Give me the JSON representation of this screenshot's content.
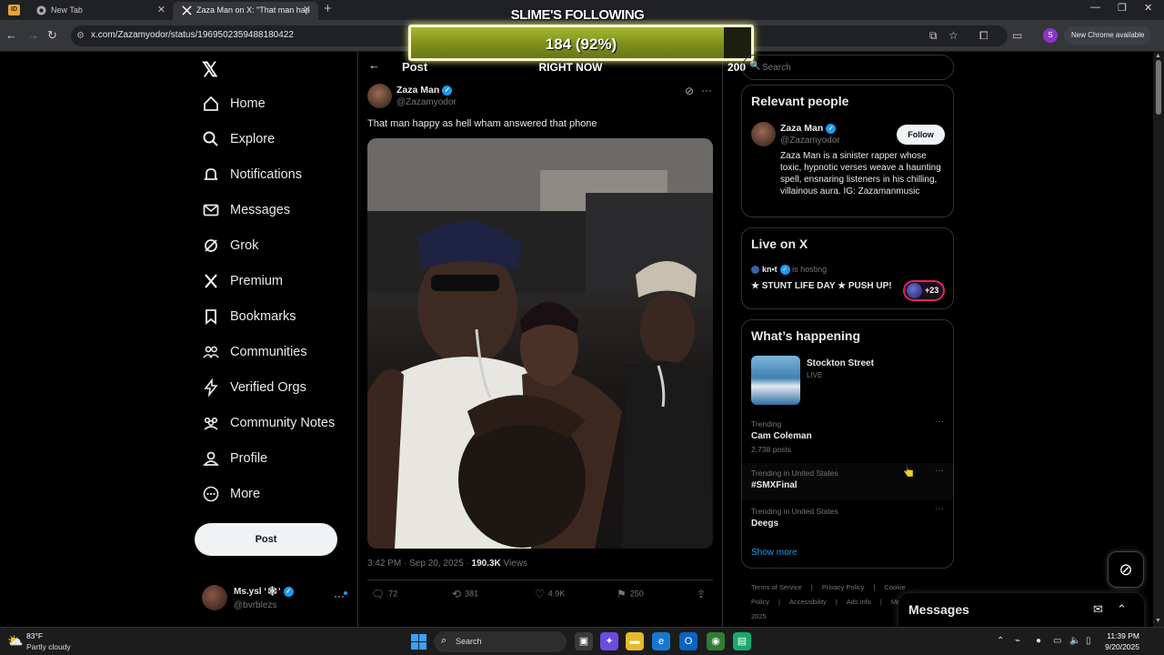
{
  "browser": {
    "tabs": [
      {
        "label": "New Tab"
      },
      {
        "label": "Zaza Man on X: \"That man hap"
      }
    ],
    "url": "x.com/Zazamyodor/status/1969502359488180422",
    "new_chrome_label": "New Chrome available",
    "profile_initial": "S",
    "app_badge": "ID"
  },
  "overlay": {
    "title": "SLIME'S FOLLOWING",
    "count_text": "184 (92%)",
    "progress_fraction": 0.92,
    "subtitle": "RIGHT NOW",
    "goal": "200"
  },
  "nav": {
    "items": [
      {
        "label": "Home",
        "icon": "home-icon"
      },
      {
        "label": "Explore",
        "icon": "search-icon"
      },
      {
        "label": "Notifications",
        "icon": "bell-icon"
      },
      {
        "label": "Messages",
        "icon": "mail-icon"
      },
      {
        "label": "Grok",
        "icon": "grok-icon"
      },
      {
        "label": "Premium",
        "icon": "x-premium-icon"
      },
      {
        "label": "Bookmarks",
        "icon": "bookmark-icon"
      },
      {
        "label": "Communities",
        "icon": "communities-icon"
      },
      {
        "label": "Verified Orgs",
        "icon": "lightning-icon"
      },
      {
        "label": "Community Notes",
        "icon": "community-notes-icon"
      },
      {
        "label": "Profile",
        "icon": "person-icon"
      },
      {
        "label": "More",
        "icon": "more-circle-icon"
      }
    ],
    "post_button": "Post",
    "account": {
      "name": "Ms.ysl ʻ🕸ʼ",
      "handle": "@bvrblezs"
    }
  },
  "post": {
    "header": "Post",
    "author_name": "Zaza Man",
    "author_handle": "@Zazamyodor",
    "text": "That man happy as hell wham answered that phone",
    "time": "3:42 PM · Sep 20, 2025 ·",
    "views_count": "190.3K",
    "views_label": " Views",
    "actions": {
      "replies": "72",
      "reposts": "381",
      "likes": "4.9K",
      "bookmarks": "250"
    }
  },
  "sidebar": {
    "search_placeholder": "Search",
    "relevant": {
      "title": "Relevant people",
      "name": "Zaza Man",
      "handle": "@Zazamyodor",
      "follow": "Follow",
      "bio": "Zaza Man is a sinister rapper whose toxic, hypnotic verses weave a haunting spell, ensnaring listeners in his chilling, villainous aura. IG: Zazamanmusic"
    },
    "live": {
      "title": "Live on X",
      "host_name": "kn•t",
      "host_suffix": " is hosting",
      "space_title": "★ STUNT LIFE DAY ★ PUSH UP!",
      "listeners": "+23"
    },
    "happening": {
      "title": "What’s happening",
      "event_title": "Stockton Street",
      "event_status": "LIVE",
      "trends": [
        {
          "context": "Trending",
          "name": "Cam Coleman",
          "posts": "2,738 posts"
        },
        {
          "context": "Trending in United States",
          "name": "#SMXFinal",
          "posts": ""
        },
        {
          "context": "Trending in United States",
          "name": "Deegs",
          "posts": ""
        }
      ],
      "show_more": "Show more"
    },
    "footer": [
      "Terms of Service",
      "|",
      "Privacy Policy",
      "|",
      "Cookie Policy",
      "|",
      "Accessibility",
      "|",
      "Ads info",
      "|",
      "More ···",
      "© 2025"
    ]
  },
  "messages_drawer": {
    "title": "Messages"
  },
  "taskbar": {
    "weather_temp": "83°F",
    "weather_desc": "Partly cloudy",
    "search_label": "Search",
    "time": "11:39 PM",
    "date": "9/20/2025"
  },
  "colors": {
    "accent": "#1d9bf0",
    "overlay_fill": "#8a9c22",
    "live_ring": "#e0245e"
  }
}
